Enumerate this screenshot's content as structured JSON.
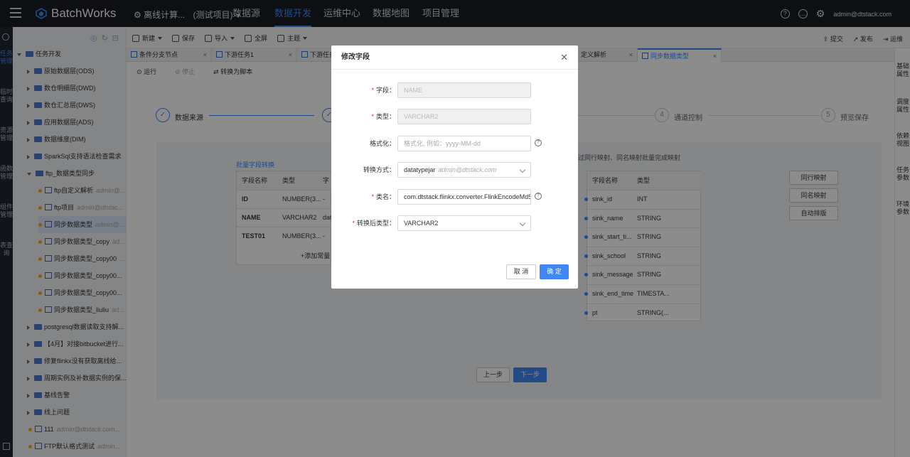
{
  "app": {
    "name": "BatchWorks",
    "project": "离线计算...",
    "project_env": "(测试项目)",
    "user": "admin@dtstack.com"
  },
  "nav": [
    "数据源",
    "数据开发",
    "运维中心",
    "数据地图",
    "项目管理"
  ],
  "left_rail": [
    "任务管理",
    "临时查询",
    "资源管理",
    "函数管理",
    "组件管理",
    "表查询"
  ],
  "tree": {
    "root": "任务开发",
    "items": [
      {
        "label": "原始数据层(ODS)",
        "kind": "folder"
      },
      {
        "label": "数仓明细层(DWD)",
        "kind": "folder"
      },
      {
        "label": "数仓汇总层(DWS)",
        "kind": "folder"
      },
      {
        "label": "应用数据层(ADS)",
        "kind": "folder"
      },
      {
        "label": "数据维度(DIM)",
        "kind": "folder"
      },
      {
        "label": "SparkSql支持语法检查需求",
        "kind": "folder"
      },
      {
        "label": "ftp_数据类型同步",
        "kind": "folder-open"
      },
      {
        "label": "ftp自定义解析",
        "owner": "admin@...",
        "kind": "file"
      },
      {
        "label": "ftp项目",
        "owner": "admin@dtstac...",
        "kind": "file"
      },
      {
        "label": "同步数据类型",
        "owner": "admin@...",
        "kind": "file-selected"
      },
      {
        "label": "同步数据类型_copy",
        "owner": "ad...",
        "kind": "file"
      },
      {
        "label": "同步数据类型_copy00",
        "owner": "...",
        "kind": "file"
      },
      {
        "label": "同步数据类型_copy00...",
        "owner": "",
        "kind": "file"
      },
      {
        "label": "同步数据类型_copy00...",
        "owner": "",
        "kind": "file"
      },
      {
        "label": "同步数据类型_liuliu",
        "owner": "ad...",
        "kind": "file"
      },
      {
        "label": "postgresql数据读取支持解...",
        "kind": "folder"
      },
      {
        "label": "【4月】对接bitbucket进行...",
        "kind": "folder"
      },
      {
        "label": "修复flinkx没有获取离线给...",
        "kind": "folder"
      },
      {
        "label": "周期实例及补数据实例的保...",
        "kind": "folder"
      },
      {
        "label": "基线告警",
        "kind": "folder"
      },
      {
        "label": "线上问题",
        "kind": "folder"
      },
      {
        "label": "111",
        "owner": "admin@dtstack.com...",
        "kind": "file-root"
      },
      {
        "label": "FTP默认格式测试",
        "owner": "admin...",
        "kind": "file-root"
      }
    ]
  },
  "toolbar": {
    "new": "新建",
    "save": "保存",
    "import": "导入",
    "fullscreen": "全屏",
    "theme": "主题",
    "submit": "提交",
    "publish": "发布",
    "ops": "运维"
  },
  "tabs": [
    "条件分支节点",
    "下游任务1",
    "下游任务",
    "定义解析",
    "同步数据类型"
  ],
  "actions": {
    "run": "运行",
    "stop": "停止",
    "convert": "转换为脚本"
  },
  "steps": [
    {
      "num": "1",
      "label": "数据来源"
    },
    {
      "num": "4",
      "label": "通道控制"
    },
    {
      "num": "5",
      "label": "预览保存"
    }
  ],
  "mapping": {
    "batch_link": "批量字段转换",
    "hint": "过同行映射、同名映射批量完成映射",
    "src_headers": [
      "字段名称",
      "类型",
      "字"
    ],
    "src_rows": [
      [
        "ID",
        "NUMBER(3...",
        "-"
      ],
      [
        "NAME",
        "VARCHAR2",
        "dat"
      ],
      [
        "TEST01",
        "NUMBER(3...",
        "-"
      ]
    ],
    "add_const": "+添加常量",
    "dst_headers": [
      "字段名称",
      "类型"
    ],
    "dst_rows": [
      [
        "sink_id",
        "INT"
      ],
      [
        "sink_name",
        "STRING"
      ],
      [
        "sink_start_ti...",
        "STRING"
      ],
      [
        "sink_school",
        "STRING"
      ],
      [
        "sink_message",
        "STRING"
      ],
      [
        "sink_end_time",
        "TIMESTA..."
      ],
      [
        "pt",
        "STRING(..."
      ]
    ],
    "btn_row": "同行映射",
    "btn_name": "同名映射",
    "btn_auto": "自动排版",
    "prev": "上一步",
    "next": "下一步"
  },
  "right_rail": [
    "基础属性",
    "调度属性",
    "依赖视图",
    "任务参数",
    "环境参数"
  ],
  "modal": {
    "title": "修改字段",
    "field_label": "字段：",
    "field_value": "NAME",
    "type_label": "类型：",
    "type_value": "VARCHAR2",
    "format_label": "格式化：",
    "format_placeholder": "格式化, 例如：yyyy-MM-dd",
    "convert_label": "转换方式：",
    "convert_value": "datatypejar",
    "convert_sub": "admin@dtstack.com",
    "class_label": "类名：",
    "class_value": "com.dtstack.flinkx.converter.FlinkEncodeMd5",
    "after_label": "转换后类型：",
    "after_value": "VARCHAR2",
    "cancel": "取 消",
    "ok": "确 定"
  },
  "colors": {
    "accent": "#3f87f5",
    "topbar": "#181c24"
  }
}
